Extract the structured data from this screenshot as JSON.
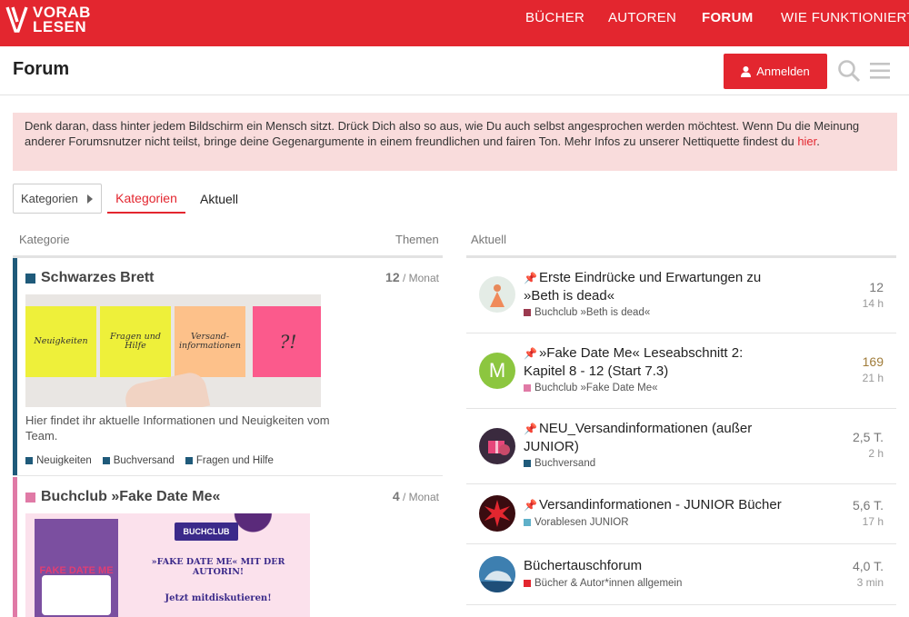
{
  "brand": {
    "line1": "VORAB",
    "line2": "LESEN"
  },
  "nav": {
    "books": "BÜCHER",
    "authors": "AUTOREN",
    "forum": "FORUM",
    "how": "WIE FUNKTIONIERT'S"
  },
  "header": {
    "title": "Forum",
    "login_label": "Anmelden"
  },
  "notice": {
    "text": "Denk daran, dass hinter jedem Bildschirm ein Mensch sitzt. Drück Dich also so aus, wie Du auch selbst angesprochen werden möchtest. Wenn Du die Meinung anderer Forumsnutzer nicht teilst, bringe deine Gegenargumente in einem freundlichen und fairen Ton. Mehr Infos zu unserer Nettiquette findest du ",
    "link": "hier",
    "end": "."
  },
  "controls": {
    "dropdown": "Kategorien",
    "tab_categories": "Kategorien",
    "tab_latest": "Aktuell"
  },
  "left": {
    "head_category": "Kategorie",
    "head_topics": "Themen",
    "categories": [
      {
        "name": "Schwarzes Brett",
        "color": "#1f5a7a",
        "count": "12",
        "period": "Monat",
        "notes": [
          "Neuigkeiten",
          "Fragen und Hilfe",
          "Versand-informationen",
          "?!"
        ],
        "description": "Hier findet ihr aktuelle Informationen und Neuigkeiten vom Team.",
        "subcategories": [
          "Neuigkeiten",
          "Buchversand",
          "Fragen und Hilfe"
        ]
      },
      {
        "name": "Buchclub »Fake Date Me«",
        "color": "#e07aa6",
        "count": "4",
        "period": "Monat",
        "banner": {
          "badge": "BUCHCLUB",
          "headline": "»FAKE DATE ME« MIT DER AUTORIN!",
          "sub": "Jetzt mitdiskutieren!",
          "book": "FAKE DATE ME"
        }
      }
    ]
  },
  "right": {
    "head": "Aktuell",
    "topics": [
      {
        "title": "Erste Eindrücke und Erwartungen zu »Beth is dead«",
        "pinned": true,
        "category": "Buchclub »Beth is dead«",
        "cat_color": "#9b3a4f",
        "posts": "12",
        "age": "14 h",
        "avatar": "figure"
      },
      {
        "title": "»Fake Date Me« Leseabschnitt 2: Kapitel 8 - 12 (Start 7.3)",
        "pinned": true,
        "category": "Buchclub »Fake Date Me«",
        "cat_color": "#e07aa6",
        "posts": "169",
        "age": "21 h",
        "avatar": "letter",
        "avatar_letter": "M",
        "hot": true
      },
      {
        "title": "NEU_Versandinformationen (außer JUNIOR)",
        "pinned": true,
        "category": "Buchversand",
        "cat_color": "#1f5a7a",
        "posts": "2,5 T.",
        "age": "2 h",
        "avatar": "gift"
      },
      {
        "title": "Versandinformationen - JUNIOR Bücher",
        "pinned": true,
        "category": "Vorablesen JUNIOR",
        "cat_color": "#5fb0c9",
        "posts": "5,6 T.",
        "age": "17 h",
        "avatar": "star"
      },
      {
        "title": "Büchertauschforum",
        "pinned": false,
        "category": "Bücher & Autor*innen allgemein",
        "cat_color": "#e3262f",
        "posts": "4,0 T.",
        "age": "3 min",
        "avatar": "whale"
      }
    ]
  }
}
